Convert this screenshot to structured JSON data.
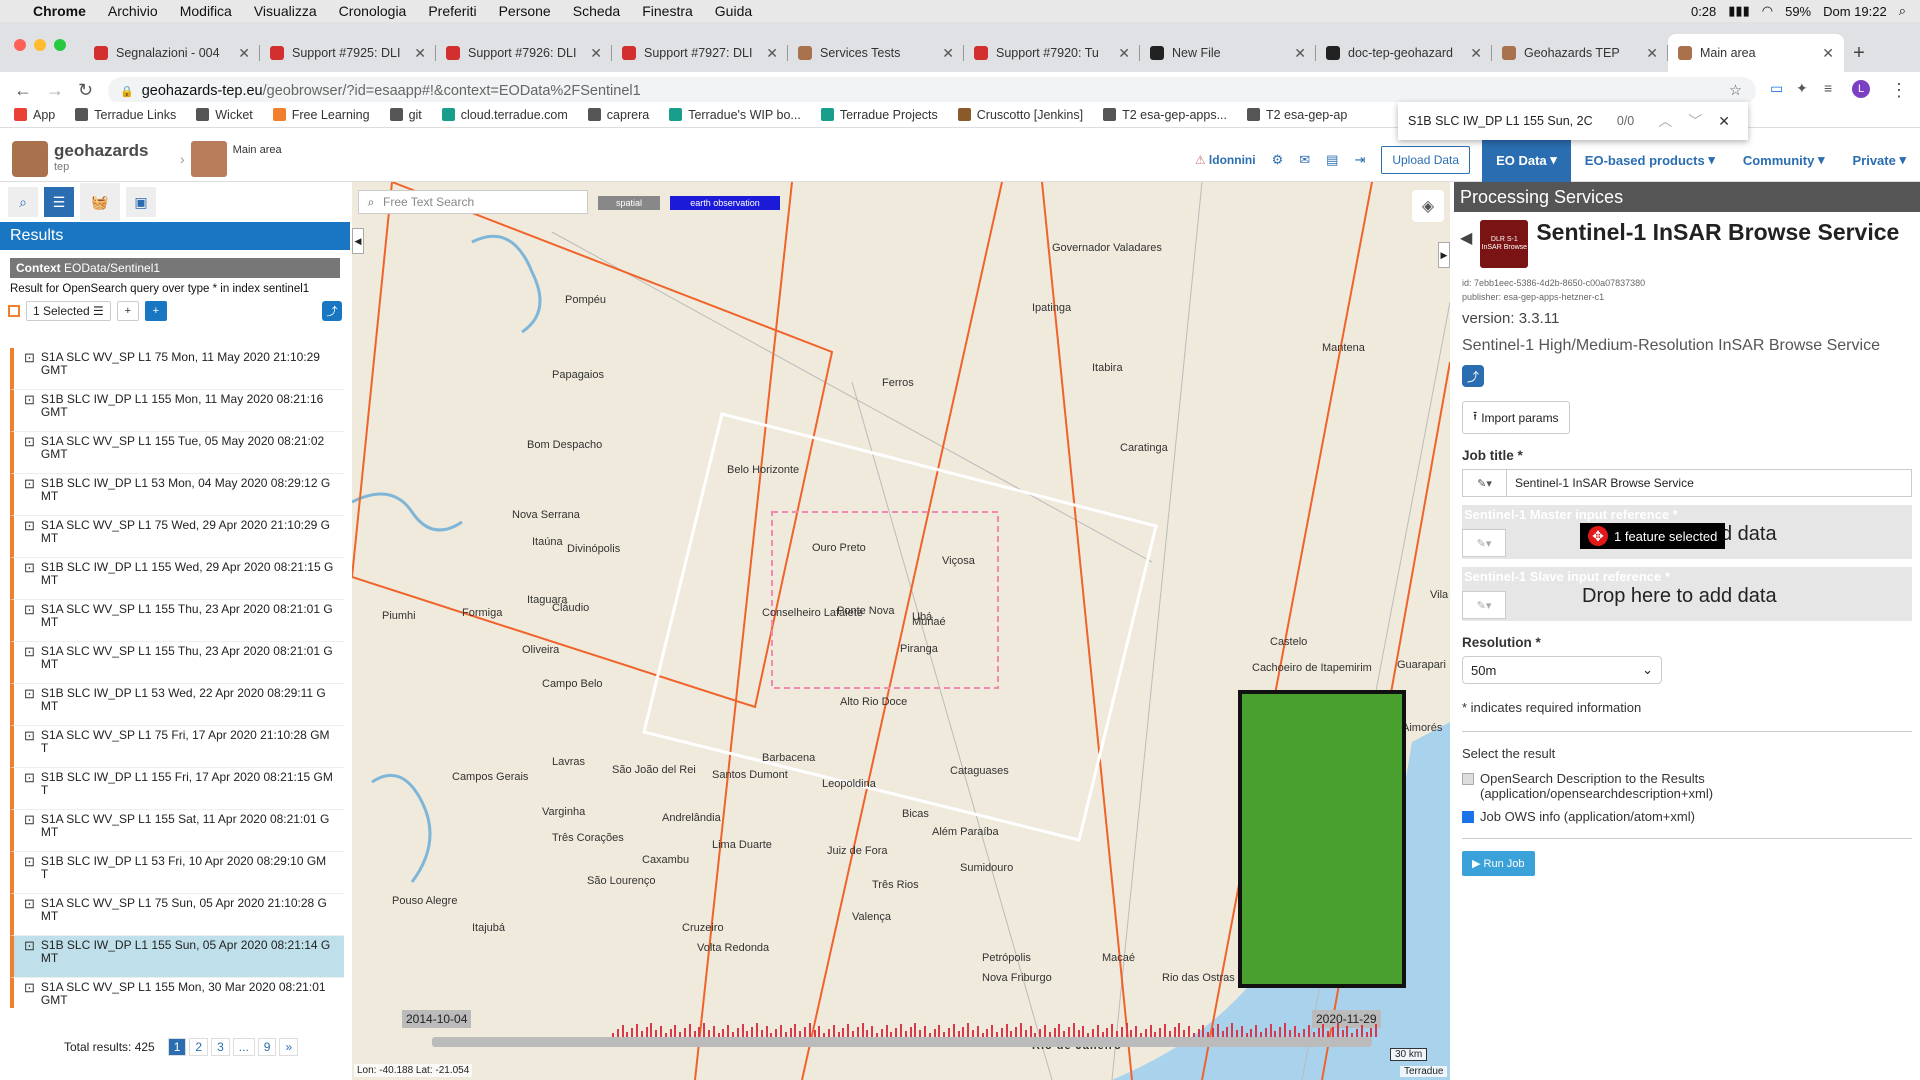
{
  "menubar": {
    "app": "Chrome",
    "items": [
      "Archivio",
      "Modifica",
      "Visualizza",
      "Cronologia",
      "Preferiti",
      "Persone",
      "Scheda",
      "Finestra",
      "Guida"
    ],
    "time_left": "0:28",
    "battery": "59%",
    "clock": "Dom 19:22"
  },
  "tabs": [
    {
      "title": "Segnalazioni - 004",
      "color": "#d32f2f"
    },
    {
      "title": "Support #7925: DLI",
      "color": "#d32f2f"
    },
    {
      "title": "Support #7926: DLI",
      "color": "#d32f2f"
    },
    {
      "title": "Support #7927: DLI",
      "color": "#d32f2f"
    },
    {
      "title": "Services Tests",
      "color": "#a9714c"
    },
    {
      "title": "Support #7920: Tu",
      "color": "#d32f2f"
    },
    {
      "title": "New File",
      "color": "#222"
    },
    {
      "title": "doc-tep-geohazard",
      "color": "#222"
    },
    {
      "title": "Geohazards TEP",
      "color": "#a9714c"
    },
    {
      "title": "Main area",
      "color": "#a9714c"
    }
  ],
  "address": {
    "host": "geohazards-tep.eu",
    "path": "/geobrowser/?id=esaapp#!&context=EOData%2FSentinel1"
  },
  "bookmarks": [
    "App",
    "Terradue Links",
    "Wicket",
    "Free Learning",
    "git",
    "cloud.terradue.com",
    "caprera",
    "Terradue's WIP bo...",
    "Terradue Projects",
    "Cruscotto [Jenkins]",
    "T2 esa-gep-apps...",
    "T2 esa-gep-ap"
  ],
  "findbar": {
    "query": "S1B SLC IW_DP L1 155 Sun, 2C",
    "count": "0/0"
  },
  "header": {
    "logo": "geohazards",
    "logo_sub": "tep",
    "breadcrumb": "Main area",
    "user": "ldonnini",
    "upload": "Upload Data",
    "nav": [
      "EO Data",
      "EO-based products",
      "Community",
      "Private"
    ]
  },
  "left": {
    "title": "Results",
    "context_label": "Context",
    "context_value": "EOData/Sentinel1",
    "query_desc": "Result for OpenSearch query over type * in index sentinel1",
    "selected": "1 Selected",
    "results": [
      {
        "line1": "S1A SLC WV_SP L1 75 Mon, 11 May 2020 21:10:29",
        "line2": "GMT",
        "sel": false
      },
      {
        "line1": "S1B SLC IW_DP L1 155 Mon, 11 May 2020 08:21:16",
        "line2": "GMT",
        "sel": false
      },
      {
        "line1": "S1A SLC WV_SP L1 155 Tue, 05 May 2020 08:21:02",
        "line2": "GMT",
        "sel": false
      },
      {
        "line1": "S1B SLC IW_DP L1 53 Mon, 04 May 2020 08:29:12 G",
        "line2": "MT",
        "sel": false
      },
      {
        "line1": "S1A SLC WV_SP L1 75 Wed, 29 Apr 2020 21:10:29 G",
        "line2": "MT",
        "sel": false
      },
      {
        "line1": "S1B SLC IW_DP L1 155 Wed, 29 Apr 2020 08:21:15 G",
        "line2": "MT",
        "sel": false
      },
      {
        "line1": "S1A SLC WV_SP L1 155 Thu, 23 Apr 2020 08:21:01 G",
        "line2": "MT",
        "sel": false
      },
      {
        "line1": "S1A SLC WV_SP L1 155 Thu, 23 Apr 2020 08:21:01 G",
        "line2": "MT",
        "sel": false
      },
      {
        "line1": "S1B SLC IW_DP L1 53 Wed, 22 Apr 2020 08:29:11 G",
        "line2": "MT",
        "sel": false
      },
      {
        "line1": "S1A SLC WV_SP L1 75 Fri, 17 Apr 2020 21:10:28 GM",
        "line2": "T",
        "sel": false
      },
      {
        "line1": "S1B SLC IW_DP L1 155 Fri, 17 Apr 2020 08:21:15 GM",
        "line2": "T",
        "sel": false
      },
      {
        "line1": "S1A SLC WV_SP L1 155 Sat, 11 Apr 2020 08:21:01 G",
        "line2": "MT",
        "sel": false
      },
      {
        "line1": "S1B SLC IW_DP L1 53 Fri, 10 Apr 2020 08:29:10 GM",
        "line2": "T",
        "sel": false
      },
      {
        "line1": "S1A SLC WV_SP L1 75 Sun, 05 Apr 2020 21:10:28 G",
        "line2": "MT",
        "sel": false
      },
      {
        "line1": "S1B SLC IW_DP L1 155 Sun, 05 Apr 2020 08:21:14 G",
        "line2": "MT",
        "sel": true
      },
      {
        "line1": "S1A SLC WV_SP L1 155 Mon, 30 Mar 2020 08:21:01",
        "line2": "GMT",
        "sel": false
      }
    ],
    "total": "Total results: 425",
    "pages": [
      "1",
      "2",
      "3",
      "...",
      "9",
      "»"
    ]
  },
  "map": {
    "search_placeholder": "Free Text Search",
    "chip_spatial": "spatial",
    "chip_eo": "earth observation",
    "date_start": "2014-10-04",
    "date_end": "2020-11-29",
    "coords": "Lon: -40.188 Lat: -21.054",
    "scale": "30 km",
    "attribution": "Terradue",
    "places": [
      {
        "t": "Belo Horizonte"
      },
      {
        "t": "Ouro Preto"
      },
      {
        "t": "Conselheiro Lafaiete"
      },
      {
        "t": "Barbacena"
      },
      {
        "t": "Juiz de Fora"
      },
      {
        "t": "Viçosa"
      },
      {
        "t": "Ubá"
      },
      {
        "t": "Muriaé"
      },
      {
        "t": "Governador Valadares"
      },
      {
        "t": "Ipatinga"
      },
      {
        "t": "Itabira"
      },
      {
        "t": "Caratinga"
      },
      {
        "t": "Petrópolis"
      },
      {
        "t": "Nova Friburgo"
      },
      {
        "t": "Volta Redonda"
      },
      {
        "t": "Macaé"
      },
      {
        "t": "Rio das Ostras"
      },
      {
        "t": "Divinópolis"
      },
      {
        "t": "Lavras"
      },
      {
        "t": "Varginha"
      },
      {
        "t": "Três Corações"
      },
      {
        "t": "Campos Gerais"
      },
      {
        "t": "Pouso Alegre"
      },
      {
        "t": "Itajubá"
      },
      {
        "t": "Cruzeiro"
      },
      {
        "t": "Rio de Janeiro"
      },
      {
        "t": "Campo Belo"
      },
      {
        "t": "Oliveira"
      },
      {
        "t": "São João del Rei"
      },
      {
        "t": "Cataguases"
      },
      {
        "t": "Leopoldina"
      },
      {
        "t": "Piranga"
      },
      {
        "t": "Ponte Nova"
      },
      {
        "t": "Alto Rio Doce"
      },
      {
        "t": "Mantena"
      },
      {
        "t": "Aimorés"
      },
      {
        "t": "Ferros"
      },
      {
        "t": "Pompéu"
      },
      {
        "t": "Papagaios"
      },
      {
        "t": "Bom Despacho"
      },
      {
        "t": "Nova Serrana"
      },
      {
        "t": "Itaúna"
      },
      {
        "t": "Itaguara"
      },
      {
        "t": "Cláudio"
      },
      {
        "t": "Piumhi"
      },
      {
        "t": "Formiga"
      },
      {
        "t": "Santos Dumont"
      },
      {
        "t": "Bicas"
      },
      {
        "t": "Além Paraíba"
      },
      {
        "t": "Sumidouro"
      },
      {
        "t": "Três Rios"
      },
      {
        "t": "Valença"
      },
      {
        "t": "Andrelândia"
      },
      {
        "t": "Caxambu"
      },
      {
        "t": "São Lourenço"
      },
      {
        "t": "Lima Duarte"
      },
      {
        "t": "Cachoeiro de Itapemirim"
      },
      {
        "t": "Castelo"
      },
      {
        "t": "Guarapari"
      },
      {
        "t": "Vila Velha"
      }
    ]
  },
  "right": {
    "panel_title": "Processing Services",
    "service_title": "Sentinel-1 InSAR Browse Service",
    "icon_text": "DLR S-1 InSAR Browse",
    "id": "id: 7ebb1eec-5386-4d2b-8650-c00a07837380",
    "publisher": "publisher: esa-gep-apps-hetzner-c1",
    "version": "version: 3.3.11",
    "desc": "Sentinel-1 High/Medium-Resolution InSAR Browse Service",
    "import": "Import params",
    "job_title_label": "Job title *",
    "job_title_value": "Sentinel-1 InSAR Browse Service",
    "master_label": "Sentinel-1 Master input reference *",
    "master_hint": "Drop here to add data",
    "tooltip": "1 feature selected",
    "slave_label": "Sentinel-1 Slave input reference *",
    "slave_hint": "Drop here to add data",
    "resolution_label": "Resolution *",
    "resolution_value": "50m",
    "required_note": "* indicates required information",
    "select_result": "Select the result",
    "opt1": "OpenSearch Description to the Results (application/opensearchdescription+xml)",
    "opt2": "Job OWS info (application/atom+xml)",
    "run": "Run Job"
  }
}
